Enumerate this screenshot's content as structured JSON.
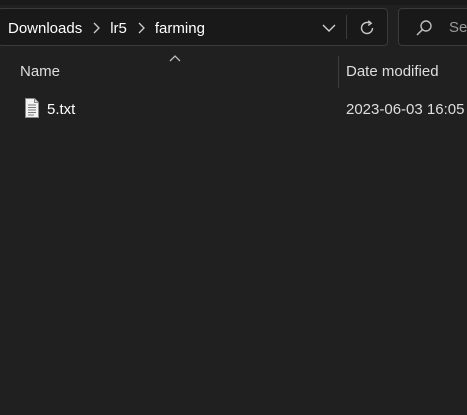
{
  "breadcrumb": {
    "items": [
      "Downloads",
      "lr5",
      "farming"
    ],
    "separator_icon": "chevron-right-icon"
  },
  "address_bar": {
    "dropdown_icon": "chevron-down-icon",
    "refresh_icon": "refresh-icon"
  },
  "search": {
    "placeholder": "Se",
    "icon": "search-icon"
  },
  "columns": {
    "name": "Name",
    "date_modified": "Date modified",
    "sort_indicator_icon": "sort-up-icon"
  },
  "files": [
    {
      "icon": "text-file-icon",
      "name": "5.txt",
      "date_modified": "2023-06-03 16:05"
    }
  ],
  "colors": {
    "background": "#202020",
    "text": "#ffffff",
    "border": "#3b3b3b"
  }
}
